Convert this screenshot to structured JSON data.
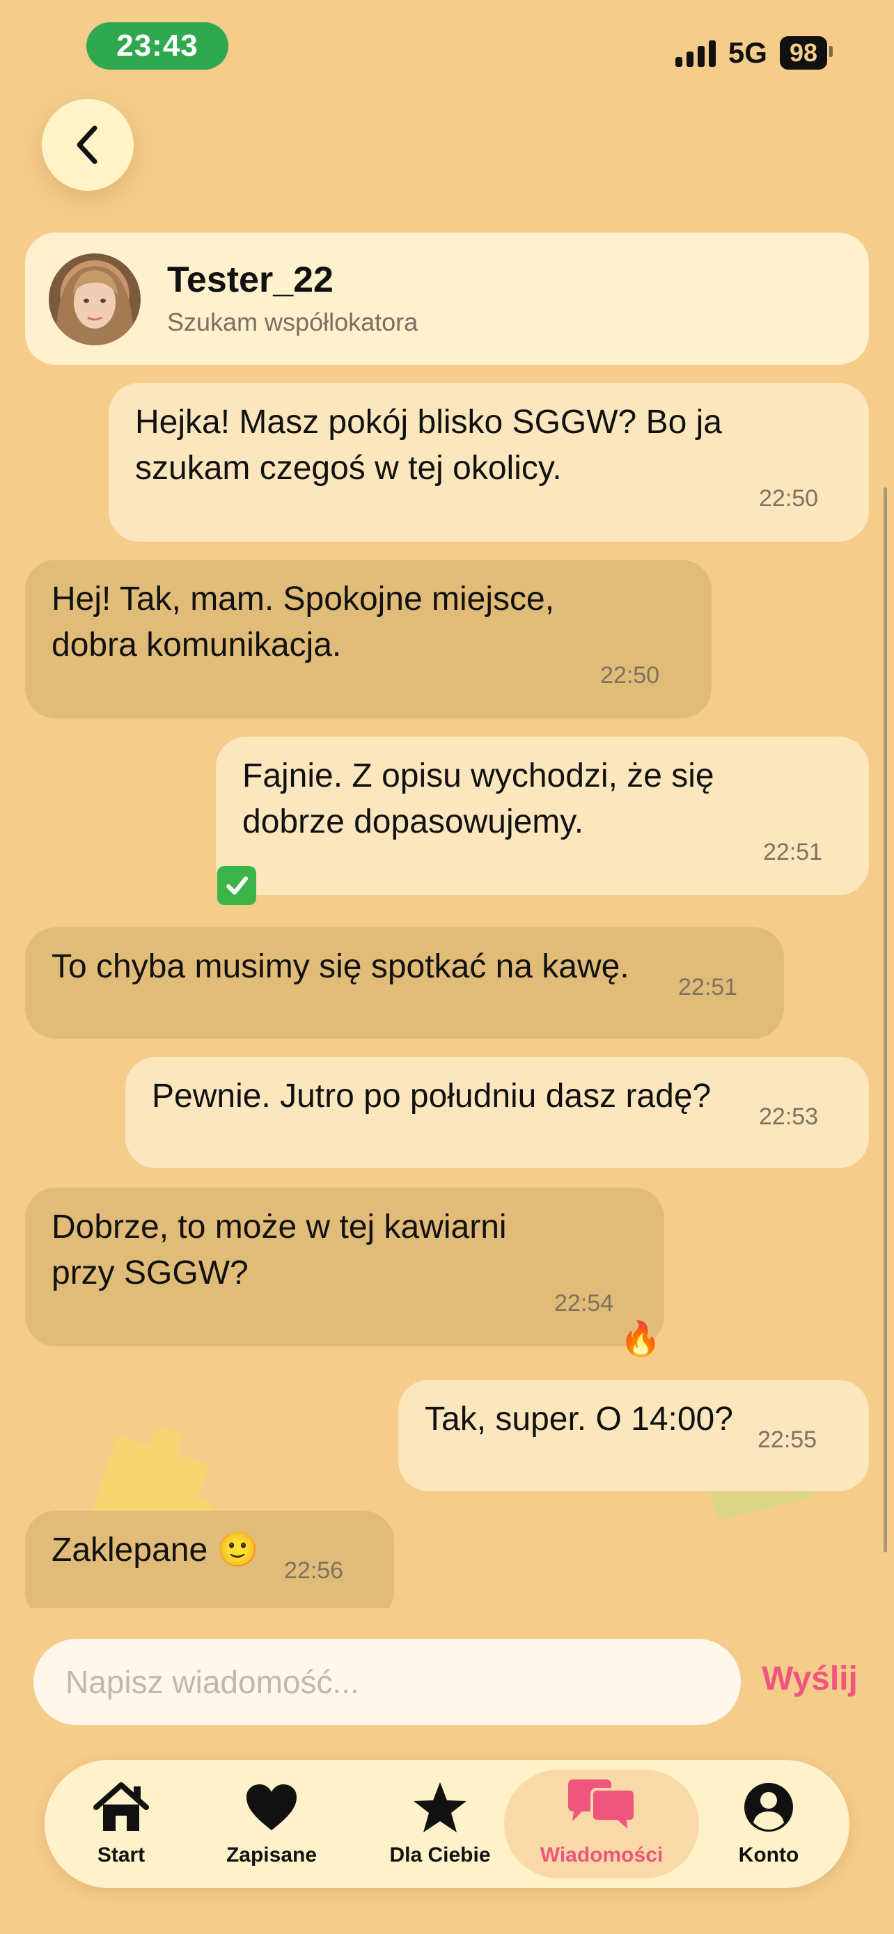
{
  "status_bar": {
    "time": "23:43",
    "network": "5G",
    "battery": "98"
  },
  "header": {
    "name": "Tester_22",
    "subtitle": "Szukam współlokatora"
  },
  "messages": [
    {
      "dir": "out",
      "text": "Hejka! Masz pokój blisko SGGW? Bo ja\nszukam czegoś w tej okolicy.",
      "time": "22:50"
    },
    {
      "dir": "in",
      "text": "Hej! Tak, mam. Spokojne miejsce,\ndobra komunikacja.",
      "time": "22:50"
    },
    {
      "dir": "out",
      "text": "Fajnie. Z opisu wychodzi, że się\ndobrze dopasowujemy.",
      "time": "22:51",
      "reaction": "check-mark-button-emoji"
    },
    {
      "dir": "in",
      "text": "To chyba musimy się spotkać na kawę.",
      "time": "22:51"
    },
    {
      "dir": "out",
      "text": "Pewnie. Jutro po południu dasz radę?",
      "time": "22:53"
    },
    {
      "dir": "in",
      "text": "Dobrze, to może w tej kawiarni\nprzy SGGW?",
      "time": "22:54",
      "reaction": "🔥"
    },
    {
      "dir": "out",
      "text": "Tak, super. O 14:00?",
      "time": "22:55"
    },
    {
      "dir": "in",
      "text": "Zaklepane 🙂",
      "time": "22:56"
    }
  ],
  "composer": {
    "placeholder": "Napisz wiadomość...",
    "send_label": "Wyślij"
  },
  "tabs": [
    {
      "label": "Start",
      "icon": "home-icon"
    },
    {
      "label": "Zapisane",
      "icon": "heart-icon"
    },
    {
      "label": "Dla Ciebie",
      "icon": "star-icon"
    },
    {
      "label": "Wiadomości",
      "icon": "chat-bubbles-icon",
      "active": true
    },
    {
      "label": "Konto",
      "icon": "account-icon"
    }
  ],
  "colors": {
    "background": "#F5CC8A",
    "accent": "#F0557D",
    "time_pill": "#2FA84F",
    "bubble_out": "#FBE6BD",
    "bubble_in": "#E1BC78"
  }
}
